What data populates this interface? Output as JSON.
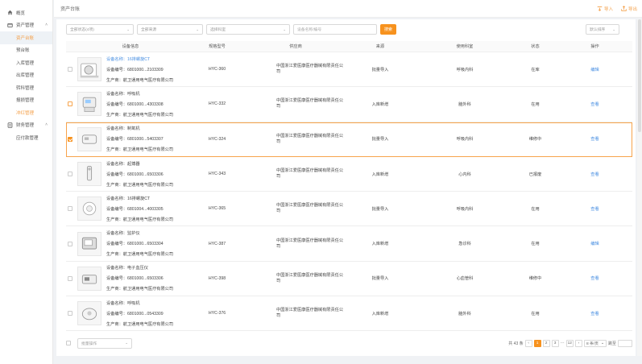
{
  "sidebar": {
    "items": [
      {
        "label": "概览",
        "icon": "home-icon"
      },
      {
        "label": "资产管理",
        "icon": "asset-icon",
        "expanded": true
      },
      {
        "label": "资产台账",
        "sub": true,
        "active": true
      },
      {
        "label": "预台账",
        "sub": true
      },
      {
        "label": "入库管理",
        "sub": true
      },
      {
        "label": "出库管理",
        "sub": true
      },
      {
        "label": "转科管理",
        "sub": true
      },
      {
        "label": "报损管理",
        "sub": true
      },
      {
        "label": "冲红管理",
        "sub": true,
        "highlight": true
      },
      {
        "label": "财务管理",
        "icon": "finance-icon",
        "expanded": true
      },
      {
        "label": "应付款管理",
        "sub": true
      }
    ]
  },
  "header": {
    "title": "资产台账",
    "import_label": "导入",
    "export_label": "导出"
  },
  "filters": {
    "status": "全部状态(4项)",
    "source": "全部来源",
    "dept": "选择科室",
    "search_placeholder": "设备名称/编号",
    "search_button": "搜索",
    "sort": "默认排序"
  },
  "table": {
    "headers": [
      "设备信息",
      "规格型号",
      "供应商",
      "来源",
      "使用科室",
      "状态",
      "操作"
    ],
    "name_prefix": "设备名称：",
    "code_prefix": "设备编号：",
    "maker_prefix": "生产商：",
    "rows": [
      {
        "name": "16排螺旋CT",
        "name_link": true,
        "code": "6801000...2103309",
        "maker": "航卫通用电气医疗有限公司",
        "model": "HYC-360",
        "supplier": "中国浙江爱医康医疗器械有限责任公司",
        "source": "批量导入",
        "dept": "呼吸内科",
        "status": "在库",
        "op": "编辑",
        "cb": "normal"
      },
      {
        "name": "呼吸机",
        "name_link": false,
        "code": "6801000...4303308",
        "maker": "航卫通用电气医疗有限公司",
        "model": "HYC-332",
        "supplier": "中国浙江爱医康医疗器械有限责任公司",
        "source": "入库新增",
        "dept": "脑外科",
        "status": "在用",
        "op": "查看",
        "cb": "orange"
      },
      {
        "name": "制氧机",
        "name_link": false,
        "code": "6801000...5403307",
        "maker": "航卫通用电气医疗有限公司",
        "model": "HYC-324",
        "supplier": "中国浙江爱医康医疗器械有限责任公司",
        "source": "批量导入",
        "dept": "呼吸内科",
        "status": "维修中",
        "op": "查看",
        "cb": "checked"
      },
      {
        "name": "起搏器",
        "name_link": false,
        "code": "6801000...6503306",
        "maker": "航卫通用电气医疗有限公司",
        "model": "HYC-343",
        "supplier": "中国浙江爱医康医疗器械有限责任公司",
        "source": "入库新增",
        "dept": "心内科",
        "status": "已报废",
        "op": "查看",
        "cb": "normal"
      },
      {
        "name": "16排螺旋CT",
        "name_link": false,
        "code": "6801004...4003305",
        "maker": "航卫通用电气医疗有限公司",
        "model": "HYC-365",
        "supplier": "中国浙江爱医康医疗器械有限责任公司",
        "source": "批量导入",
        "dept": "呼吸内科",
        "status": "在用",
        "op": "查看",
        "cb": "normal"
      },
      {
        "name": "监护仪",
        "name_link": false,
        "code": "6801000...6503304",
        "maker": "航卫通用电气医疗有限公司",
        "model": "HYC-387",
        "supplier": "中国浙江爱医康医疗器械有限责任公司",
        "source": "入库新增",
        "dept": "急诊科",
        "status": "在用",
        "op": "编辑",
        "cb": "normal"
      },
      {
        "name": "电子血压仪",
        "name_link": false,
        "code": "6801000...6503306",
        "maker": "航卫通用电气医疗有限公司",
        "model": "HYC-398",
        "supplier": "中国浙江爱医康医疗器械有限责任公司",
        "source": "批量导入",
        "dept": "心血管科",
        "status": "维修中",
        "op": "查看",
        "cb": "normal"
      },
      {
        "name": "呼吸机",
        "name_link": false,
        "code": "6801000...0543309",
        "maker": "航卫通用电气医疗有限公司",
        "model": "HYC-376",
        "supplier": "中国浙江爱医康医疗器械有限责任公司",
        "source": "入库新增",
        "dept": "脑外科",
        "status": "在用",
        "op": "查看",
        "cb": "normal"
      }
    ]
  },
  "footer": {
    "batch": "批量操作",
    "total": "共 43 条",
    "prev": "‹",
    "pages": [
      "1",
      "2",
      "3"
    ],
    "ellipsis": "···",
    "last_page": "12",
    "next": "›",
    "page_size": "8 条/页",
    "jump_label": "跳至",
    "jump_value": ""
  },
  "colors": {
    "accent": "#f7921e",
    "link": "#4a90e2"
  }
}
